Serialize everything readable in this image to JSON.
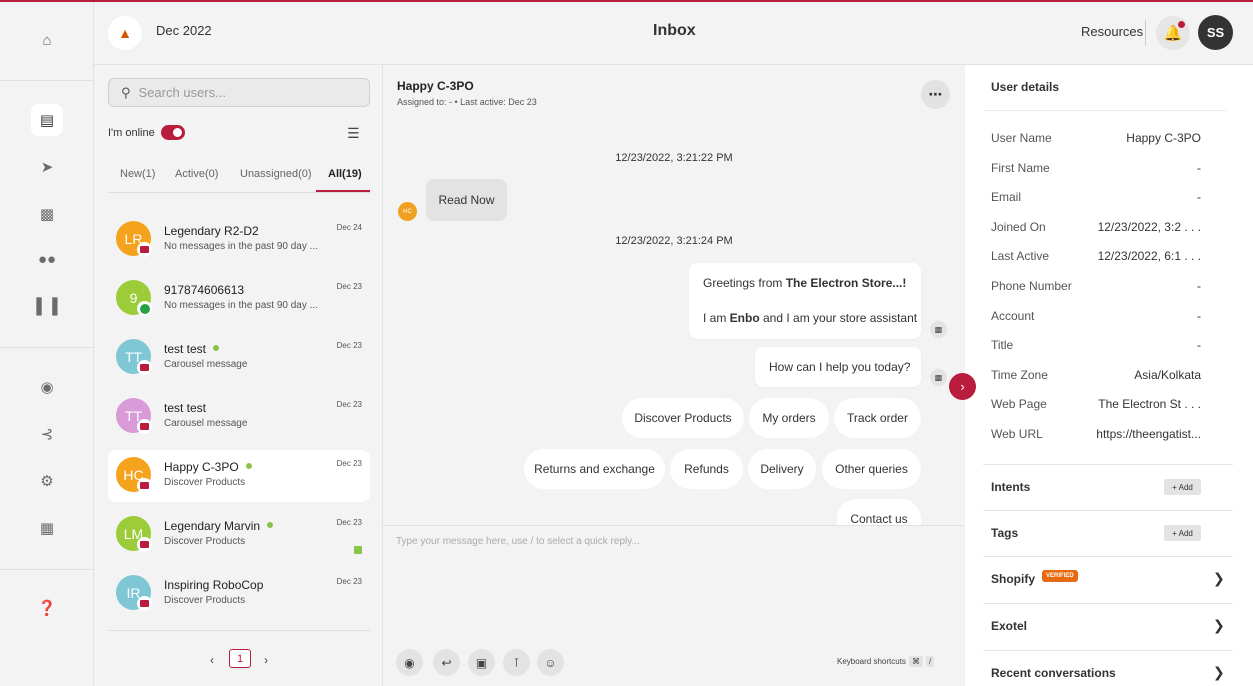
{
  "header": {
    "date": "Dec 2022",
    "title": "Inbox",
    "resources": "Resources",
    "avatar": "SS"
  },
  "rail": {
    "icons": [
      "home-icon",
      "chat-icon",
      "megaphone-icon",
      "bot-icon",
      "users-icon",
      "bar-chart-icon",
      "lightbulb-icon",
      "integrations-icon",
      "settings-icon",
      "apps-icon",
      "help-icon"
    ]
  },
  "list": {
    "search_placeholder": "Search users...",
    "online_label": "I'm online",
    "tabs": [
      "New(1)",
      "Active(0)",
      "Unassigned(0)",
      "All(19)"
    ],
    "active_tab": "All(19)",
    "conversations": [
      {
        "initials": "LR",
        "name": "Legendary R2-D2",
        "preview": "No messages in the past 90 day ...",
        "date": "Dec 24",
        "color": "#f5a21c",
        "channel": "web",
        "online": false
      },
      {
        "initials": "9",
        "name": "917874606613",
        "preview": "No messages in the past 90 day ...",
        "date": "Dec 23",
        "color": "#9ccc3a",
        "channel": "whatsapp",
        "online": false
      },
      {
        "initials": "TT",
        "name": "test test",
        "preview": "Carousel message",
        "date": "Dec 23",
        "color": "#7fc7d4",
        "channel": "web",
        "online": true
      },
      {
        "initials": "TT",
        "name": "test test",
        "preview": "Carousel message",
        "date": "Dec 23",
        "color": "#d99ad8",
        "channel": "web",
        "online": false
      },
      {
        "initials": "HC",
        "name": "Happy C-3PO",
        "preview": "Discover Products",
        "date": "Dec 23",
        "color": "#f5a21c",
        "channel": "web",
        "online": true
      },
      {
        "initials": "LM",
        "name": "Legendary Marvin",
        "preview": "Discover Products",
        "date": "Dec 23",
        "color": "#9ccc3a",
        "channel": "web",
        "online": true
      },
      {
        "initials": "IR",
        "name": "Inspiring RoboCop",
        "preview": "Discover Products",
        "date": "Dec 23",
        "color": "#7fc7d4",
        "channel": "web",
        "online": false
      }
    ],
    "page": "1"
  },
  "chat": {
    "name": "Happy C-3PO",
    "subtitle": "Assigned to: - • Last active: Dec 23",
    "timestamp1": "12/23/2022, 3:21:22 PM",
    "user_message": "Read Now",
    "user_initials": "HC",
    "timestamp2": "12/23/2022, 3:21:24 PM",
    "bot_greeting_prefix": "Greetings from ",
    "bot_greeting_store": "The Electron Store...!",
    "bot_intro_prefix": "I am ",
    "bot_intro_name": "Enbo",
    "bot_intro_suffix": " and I am your store assistant",
    "bot_help": "How can I help you today?",
    "quick_replies_row1": [
      "Discover Products",
      "My orders",
      "Track order"
    ],
    "quick_replies_row2": [
      "Returns and exchange",
      "Refunds",
      "Delivery",
      "Other queries"
    ],
    "quick_replies_row3": [
      "Contact us"
    ],
    "composer_placeholder": "Type your message here, use / to select a quick reply...",
    "keyboard_shortcuts": "Keyboard shortcuts",
    "kbd_keys": [
      "⌘",
      "/"
    ]
  },
  "details": {
    "title": "User details",
    "fields": [
      {
        "label": "User Name",
        "value": "Happy C-3PO"
      },
      {
        "label": "First Name",
        "value": "-"
      },
      {
        "label": "Email",
        "value": "-"
      },
      {
        "label": "Joined On",
        "value": "12/23/2022, 3:2 . . ."
      },
      {
        "label": "Last Active",
        "value": "12/23/2022, 6:1 . . ."
      },
      {
        "label": "Phone Number",
        "value": "-"
      },
      {
        "label": "Account",
        "value": "-"
      },
      {
        "label": "Title",
        "value": "-"
      },
      {
        "label": "Time Zone",
        "value": "Asia/Kolkata"
      },
      {
        "label": "Web Page",
        "value": "The Electron St . . ."
      },
      {
        "label": "Web URL",
        "value": "https://theengatist..."
      }
    ],
    "sections": {
      "intents": "Intents",
      "tags": "Tags",
      "add_label": "+ Add",
      "shopify": "Shopify",
      "verified": "VERIFIED",
      "exotel": "Exotel",
      "recent": "Recent conversations"
    }
  },
  "colors": {
    "accent": "#b91c3c",
    "online": "#8bc34a"
  }
}
